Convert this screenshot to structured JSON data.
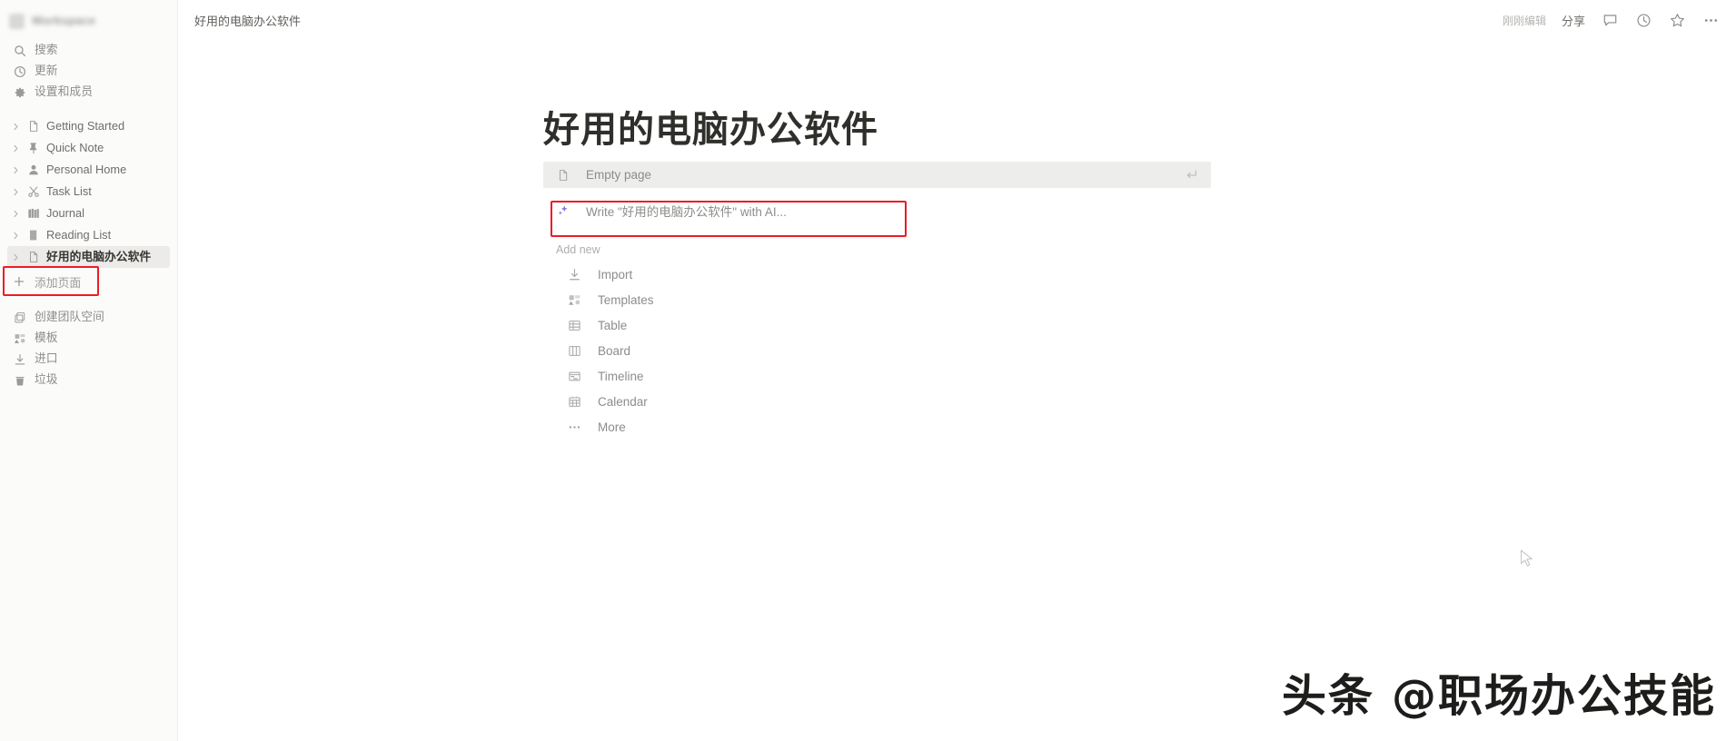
{
  "sidebar": {
    "workspace": {
      "name": "Workspace",
      "avatar_icon": "workspace-avatar"
    },
    "nav": [
      {
        "label": "搜索",
        "icon": "search-icon"
      },
      {
        "label": "更新",
        "icon": "clock-icon"
      },
      {
        "label": "设置和成员",
        "icon": "gear-icon"
      }
    ],
    "pages": [
      {
        "label": "Getting Started",
        "icon": "document-icon",
        "selected": false
      },
      {
        "label": "Quick Note",
        "icon": "pushpin-icon",
        "selected": false
      },
      {
        "label": "Personal Home",
        "icon": "person-icon",
        "selected": false
      },
      {
        "label": "Task List",
        "icon": "scissors-icon",
        "selected": false
      },
      {
        "label": "Journal",
        "icon": "books-icon",
        "selected": false
      },
      {
        "label": "Reading List",
        "icon": "notebook-icon",
        "selected": false
      },
      {
        "label": "好用的电脑办公软件",
        "icon": "document-icon",
        "selected": true
      }
    ],
    "add_page": {
      "label": "添加页面",
      "icon": "plus-icon"
    },
    "bottom": [
      {
        "label": "创建团队空间",
        "icon": "teamspace-icon"
      },
      {
        "label": "模板",
        "icon": "templates-icon"
      },
      {
        "label": "进口",
        "icon": "import-icon"
      },
      {
        "label": "垃圾",
        "icon": "trash-icon"
      }
    ]
  },
  "topbar": {
    "breadcrumb": "好用的电脑办公软件",
    "edited": "刚刚编辑",
    "share": "分享",
    "icons": [
      {
        "name": "comment-icon"
      },
      {
        "name": "history-clock-icon"
      },
      {
        "name": "star-icon"
      },
      {
        "name": "more-icon"
      }
    ]
  },
  "page": {
    "title": "好用的电脑办公软件",
    "suggestions": [
      {
        "label": "Empty page",
        "icon": "document-icon",
        "highlighted": true,
        "enter_hint": "return-icon"
      },
      {
        "label": "Write \"好用的电脑办公软件\" with AI...",
        "icon": "ai-sparkle-icon",
        "highlighted": false,
        "boxed": true
      }
    ],
    "add_new_heading": "Add new",
    "add_new": [
      {
        "label": "Import",
        "icon": "import-arrow-icon"
      },
      {
        "label": "Templates",
        "icon": "templates-icon"
      },
      {
        "label": "Table",
        "icon": "table-icon"
      },
      {
        "label": "Board",
        "icon": "board-icon"
      },
      {
        "label": "Timeline",
        "icon": "timeline-icon"
      },
      {
        "label": "Calendar",
        "icon": "calendar-icon"
      },
      {
        "label": "More",
        "icon": "ellipsis-icon"
      }
    ]
  },
  "watermark": {
    "text": "头条 @职场办公技能"
  },
  "colors": {
    "annotation": "#ec1c24",
    "highlight": "#ededec",
    "ai_accent": "#8a6fd6",
    "sidebar_bg": "#fbfbfa"
  }
}
